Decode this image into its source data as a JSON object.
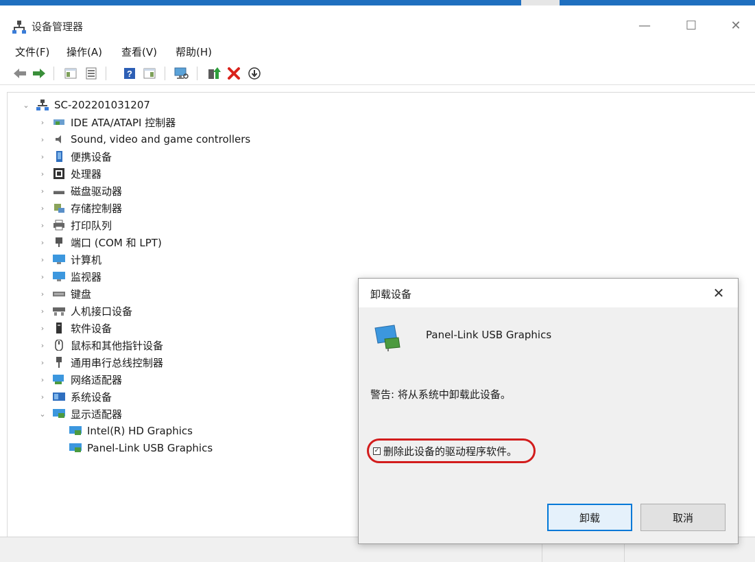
{
  "window": {
    "title": "设备管理器",
    "min_glyph": "—",
    "max_glyph": "☐",
    "close_glyph": "✕"
  },
  "menu": [
    "文件(F)",
    "操作(A)",
    "查看(V)",
    "帮助(H)"
  ],
  "toolbar": {
    "icons": [
      "back-arrow-icon",
      "forward-arrow-icon",
      "properties-pane-icon",
      "properties-icon",
      "help-icon",
      "details-pane-icon",
      "scan-hardware-icon",
      "update-driver-icon",
      "uninstall-icon",
      "disable-device-icon"
    ]
  },
  "tree": {
    "root": "SC-202201031207",
    "categories": [
      "IDE ATA/ATAPI 控制器",
      "Sound, video and game controllers",
      "便携设备",
      "处理器",
      "磁盘驱动器",
      "存储控制器",
      "打印队列",
      "端口 (COM 和 LPT)",
      "计算机",
      "监视器",
      "键盘",
      "人机接口设备",
      "软件设备",
      "鼠标和其他指针设备",
      "通用串行总线控制器",
      "网络适配器",
      "系统设备",
      "显示适配器"
    ],
    "display_children": [
      "Intel(R) HD Graphics",
      "Panel-Link USB Graphics"
    ]
  },
  "dialog": {
    "title": "卸载设备",
    "close_glyph": "✕",
    "device_name": "Panel-Link USB Graphics",
    "warning": "警告: 将从系统中卸载此设备。",
    "checkbox_label": "删除此设备的驱动程序软件。",
    "checkbox_checked": true,
    "checkbox_glyph": "✓",
    "uninstall_button": "卸载",
    "cancel_button": "取消"
  },
  "colors": {
    "accent": "#0078d7",
    "highlight_circle": "#d21c1c",
    "delete_red": "#d9231c"
  }
}
